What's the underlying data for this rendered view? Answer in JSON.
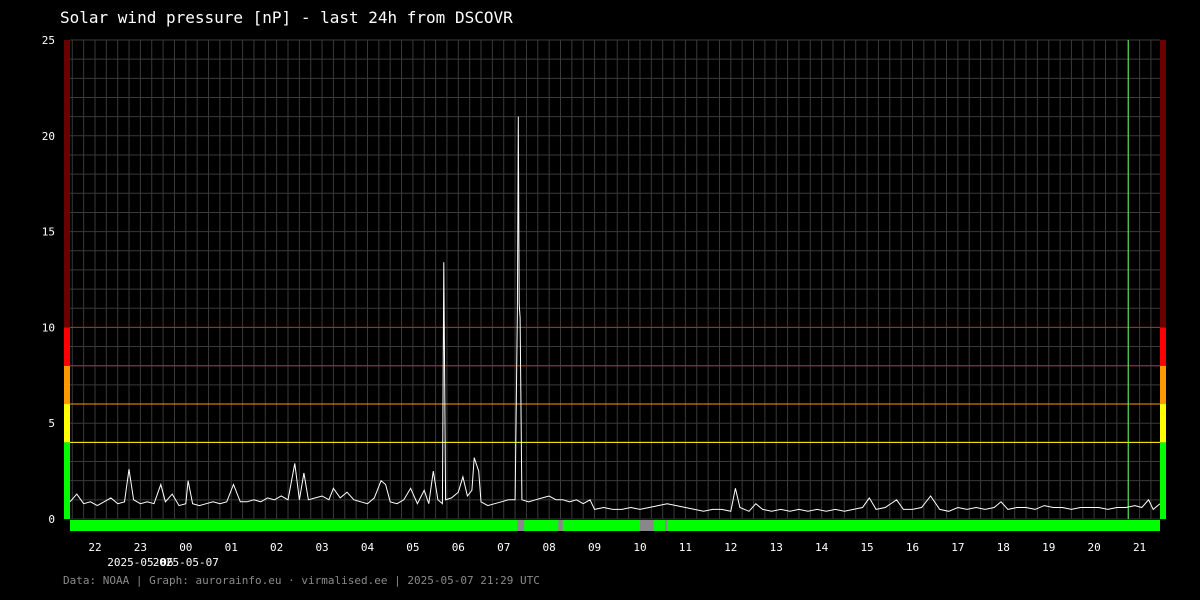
{
  "title": "Solar wind pressure [nP] - last 24h from DSCOVR",
  "footer": "Data: NOAA | Graph: aurorainfo.eu · virmalised.ee | 2025-05-07 21:29 UTC",
  "colors": {
    "background": "#000000",
    "grid": "#3a3a3a",
    "series": "#ffffff",
    "level_dark_red": "#6b0000",
    "level_red": "#ff0000",
    "level_orange": "#ff9900",
    "level_yellow": "#ffff00",
    "level_green": "#00ff00",
    "now_marker": "#66ff66"
  },
  "chart_data": {
    "type": "line",
    "title": "Solar wind pressure [nP] - last 24h from DSCOVR",
    "xlabel": "",
    "ylabel": "",
    "ylim": [
      0,
      25
    ],
    "xlim": [
      21.35,
      21.45
    ],
    "yticks": [
      0,
      5,
      10,
      15,
      20,
      25
    ],
    "x_ticks": [
      {
        "x": 22,
        "label": "22"
      },
      {
        "x": 23,
        "label": "23"
      },
      {
        "x": 24,
        "label": "00"
      },
      {
        "x": 25,
        "label": "01"
      },
      {
        "x": 26,
        "label": "02"
      },
      {
        "x": 27,
        "label": "03"
      },
      {
        "x": 28,
        "label": "04"
      },
      {
        "x": 29,
        "label": "05"
      },
      {
        "x": 30,
        "label": "06"
      },
      {
        "x": 31,
        "label": "07"
      },
      {
        "x": 32,
        "label": "08"
      },
      {
        "x": 33,
        "label": "09"
      },
      {
        "x": 34,
        "label": "10"
      },
      {
        "x": 35,
        "label": "11"
      },
      {
        "x": 36,
        "label": "12"
      },
      {
        "x": 37,
        "label": "13"
      },
      {
        "x": 38,
        "label": "14"
      },
      {
        "x": 39,
        "label": "15"
      },
      {
        "x": 40,
        "label": "16"
      },
      {
        "x": 41,
        "label": "17"
      },
      {
        "x": 42,
        "label": "18"
      },
      {
        "x": 43,
        "label": "19"
      },
      {
        "x": 44,
        "label": "20"
      },
      {
        "x": 45,
        "label": "21"
      }
    ],
    "date_labels": [
      {
        "x": 23,
        "label": "2025-05-06"
      },
      {
        "x": 24,
        "label": "2025-05-07"
      }
    ],
    "x_unit": "hours (UTC) from 2025-05-06 00:00",
    "x_range": [
      21.45,
      45.45
    ],
    "grid": true,
    "threshold_lines": [
      {
        "y": 10,
        "color": "#cc2222"
      },
      {
        "y": 8,
        "color": "#cc2222"
      },
      {
        "y": 6,
        "color": "#ff9900"
      },
      {
        "y": 4,
        "color": "#ffff00"
      }
    ],
    "level_bands": [
      {
        "from": 0,
        "to": 4,
        "color": "#00ff00"
      },
      {
        "from": 4,
        "to": 6,
        "color": "#ffff00"
      },
      {
        "from": 6,
        "to": 8,
        "color": "#ff9900"
      },
      {
        "from": 8,
        "to": 10,
        "color": "#ff0000"
      },
      {
        "from": 10,
        "to": 25,
        "color": "#6b0000"
      }
    ],
    "now_marker_x": 44.75,
    "data_gaps": [
      [
        31.3,
        31.45
      ],
      [
        32.2,
        32.3
      ],
      [
        34.0,
        34.3
      ],
      [
        34.55,
        34.6
      ]
    ],
    "series": [
      {
        "points": [
          [
            21.45,
            0.9
          ],
          [
            21.6,
            1.3
          ],
          [
            21.75,
            0.8
          ],
          [
            21.9,
            0.9
          ],
          [
            22.05,
            0.7
          ],
          [
            22.2,
            0.9
          ],
          [
            22.35,
            1.1
          ],
          [
            22.5,
            0.8
          ],
          [
            22.65,
            0.9
          ],
          [
            22.75,
            2.6
          ],
          [
            22.85,
            1.0
          ],
          [
            23.0,
            0.8
          ],
          [
            23.15,
            0.9
          ],
          [
            23.3,
            0.8
          ],
          [
            23.45,
            1.8
          ],
          [
            23.55,
            0.9
          ],
          [
            23.7,
            1.3
          ],
          [
            23.85,
            0.7
          ],
          [
            24.0,
            0.8
          ],
          [
            24.05,
            2.0
          ],
          [
            24.15,
            0.8
          ],
          [
            24.3,
            0.7
          ],
          [
            24.45,
            0.8
          ],
          [
            24.6,
            0.9
          ],
          [
            24.75,
            0.8
          ],
          [
            24.9,
            0.9
          ],
          [
            25.05,
            1.8
          ],
          [
            25.2,
            0.9
          ],
          [
            25.35,
            0.9
          ],
          [
            25.5,
            1.0
          ],
          [
            25.65,
            0.9
          ],
          [
            25.8,
            1.1
          ],
          [
            25.95,
            1.0
          ],
          [
            26.1,
            1.2
          ],
          [
            26.25,
            1.0
          ],
          [
            26.4,
            2.9
          ],
          [
            26.5,
            1.0
          ],
          [
            26.6,
            2.4
          ],
          [
            26.7,
            1.0
          ],
          [
            26.85,
            1.1
          ],
          [
            27.0,
            1.2
          ],
          [
            27.15,
            1.0
          ],
          [
            27.25,
            1.6
          ],
          [
            27.4,
            1.1
          ],
          [
            27.55,
            1.4
          ],
          [
            27.7,
            1.0
          ],
          [
            27.85,
            0.9
          ],
          [
            28.0,
            0.8
          ],
          [
            28.15,
            1.1
          ],
          [
            28.3,
            2.0
          ],
          [
            28.4,
            1.8
          ],
          [
            28.5,
            0.9
          ],
          [
            28.65,
            0.8
          ],
          [
            28.8,
            1.0
          ],
          [
            28.95,
            1.6
          ],
          [
            29.1,
            0.8
          ],
          [
            29.25,
            1.5
          ],
          [
            29.35,
            0.8
          ],
          [
            29.45,
            2.5
          ],
          [
            29.55,
            1.0
          ],
          [
            29.65,
            0.8
          ],
          [
            29.68,
            13.4
          ],
          [
            29.7,
            7.0
          ],
          [
            29.72,
            1.0
          ],
          [
            29.85,
            1.1
          ],
          [
            30.0,
            1.4
          ],
          [
            30.1,
            2.2
          ],
          [
            30.2,
            1.2
          ],
          [
            30.3,
            1.5
          ],
          [
            30.35,
            3.2
          ],
          [
            30.45,
            2.5
          ],
          [
            30.5,
            0.9
          ],
          [
            30.65,
            0.7
          ],
          [
            30.8,
            0.8
          ],
          [
            30.95,
            0.9
          ],
          [
            31.1,
            1.0
          ],
          [
            31.25,
            1.0
          ],
          [
            31.3,
            10.9
          ],
          [
            31.32,
            21.0
          ],
          [
            31.34,
            11.2
          ],
          [
            31.36,
            10.5
          ],
          [
            31.4,
            1.0
          ],
          [
            31.55,
            0.9
          ],
          [
            31.7,
            1.0
          ],
          [
            31.85,
            1.1
          ],
          [
            32.0,
            1.2
          ],
          [
            32.15,
            1.0
          ],
          [
            32.3,
            1.0
          ],
          [
            32.45,
            0.9
          ],
          [
            32.6,
            1.0
          ],
          [
            32.75,
            0.8
          ],
          [
            32.9,
            1.0
          ],
          [
            33.0,
            0.5
          ],
          [
            33.2,
            0.6
          ],
          [
            33.4,
            0.5
          ],
          [
            33.6,
            0.5
          ],
          [
            33.8,
            0.6
          ],
          [
            34.0,
            0.5
          ],
          [
            34.2,
            0.6
          ],
          [
            34.4,
            0.7
          ],
          [
            34.6,
            0.8
          ],
          [
            34.8,
            0.7
          ],
          [
            35.0,
            0.6
          ],
          [
            35.2,
            0.5
          ],
          [
            35.4,
            0.4
          ],
          [
            35.6,
            0.5
          ],
          [
            35.8,
            0.5
          ],
          [
            36.0,
            0.4
          ],
          [
            36.1,
            1.6
          ],
          [
            36.2,
            0.6
          ],
          [
            36.4,
            0.4
          ],
          [
            36.55,
            0.8
          ],
          [
            36.7,
            0.5
          ],
          [
            36.9,
            0.4
          ],
          [
            37.1,
            0.5
          ],
          [
            37.3,
            0.4
          ],
          [
            37.5,
            0.5
          ],
          [
            37.7,
            0.4
          ],
          [
            37.9,
            0.5
          ],
          [
            38.1,
            0.4
          ],
          [
            38.3,
            0.5
          ],
          [
            38.5,
            0.4
          ],
          [
            38.7,
            0.5
          ],
          [
            38.9,
            0.6
          ],
          [
            39.05,
            1.1
          ],
          [
            39.2,
            0.5
          ],
          [
            39.4,
            0.6
          ],
          [
            39.65,
            1.0
          ],
          [
            39.8,
            0.5
          ],
          [
            40.0,
            0.5
          ],
          [
            40.2,
            0.6
          ],
          [
            40.4,
            1.2
          ],
          [
            40.6,
            0.5
          ],
          [
            40.8,
            0.4
          ],
          [
            41.0,
            0.6
          ],
          [
            41.2,
            0.5
          ],
          [
            41.4,
            0.6
          ],
          [
            41.6,
            0.5
          ],
          [
            41.8,
            0.6
          ],
          [
            41.95,
            0.9
          ],
          [
            42.1,
            0.5
          ],
          [
            42.3,
            0.6
          ],
          [
            42.5,
            0.6
          ],
          [
            42.7,
            0.5
          ],
          [
            42.9,
            0.7
          ],
          [
            43.1,
            0.6
          ],
          [
            43.3,
            0.6
          ],
          [
            43.5,
            0.5
          ],
          [
            43.7,
            0.6
          ],
          [
            43.9,
            0.6
          ],
          [
            44.1,
            0.6
          ],
          [
            44.3,
            0.5
          ],
          [
            44.5,
            0.6
          ],
          [
            44.7,
            0.6
          ],
          [
            44.9,
            0.7
          ],
          [
            45.05,
            0.6
          ],
          [
            45.2,
            1.0
          ],
          [
            45.3,
            0.5
          ],
          [
            45.45,
            0.8
          ]
        ]
      }
    ]
  }
}
